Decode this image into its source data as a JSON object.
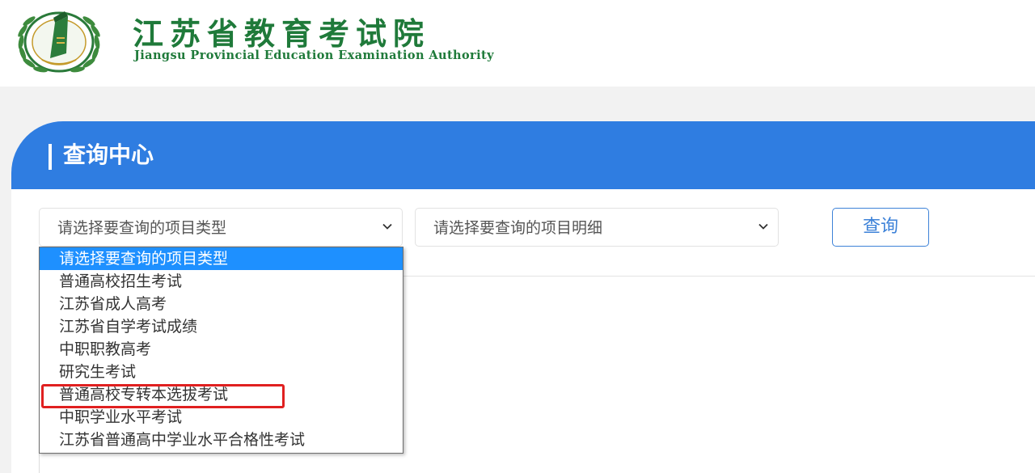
{
  "header": {
    "org_name_cn": "江苏省教育考试院",
    "org_name_en": "Jiangsu Provincial Education Examination Authority"
  },
  "panel": {
    "title": "查询中心"
  },
  "select_type": {
    "value": "请选择要查询的项目类型",
    "options": [
      "请选择要查询的项目类型",
      "普通高校招生考试",
      "江苏省成人高考",
      "江苏省自学考试成绩",
      "中职职教高考",
      "研究生考试",
      "普通高校专转本选拔考试",
      "中职学业水平考试",
      "江苏省普通高中学业水平合格性考试"
    ]
  },
  "select_detail": {
    "value": "请选择要查询的项目明细"
  },
  "query_button": {
    "label": "查询"
  },
  "colors": {
    "brand_green": "#1f7a3a",
    "panel_blue": "#2f7de1",
    "selected_option": "#1e90ff",
    "highlight_red": "#e02020"
  }
}
